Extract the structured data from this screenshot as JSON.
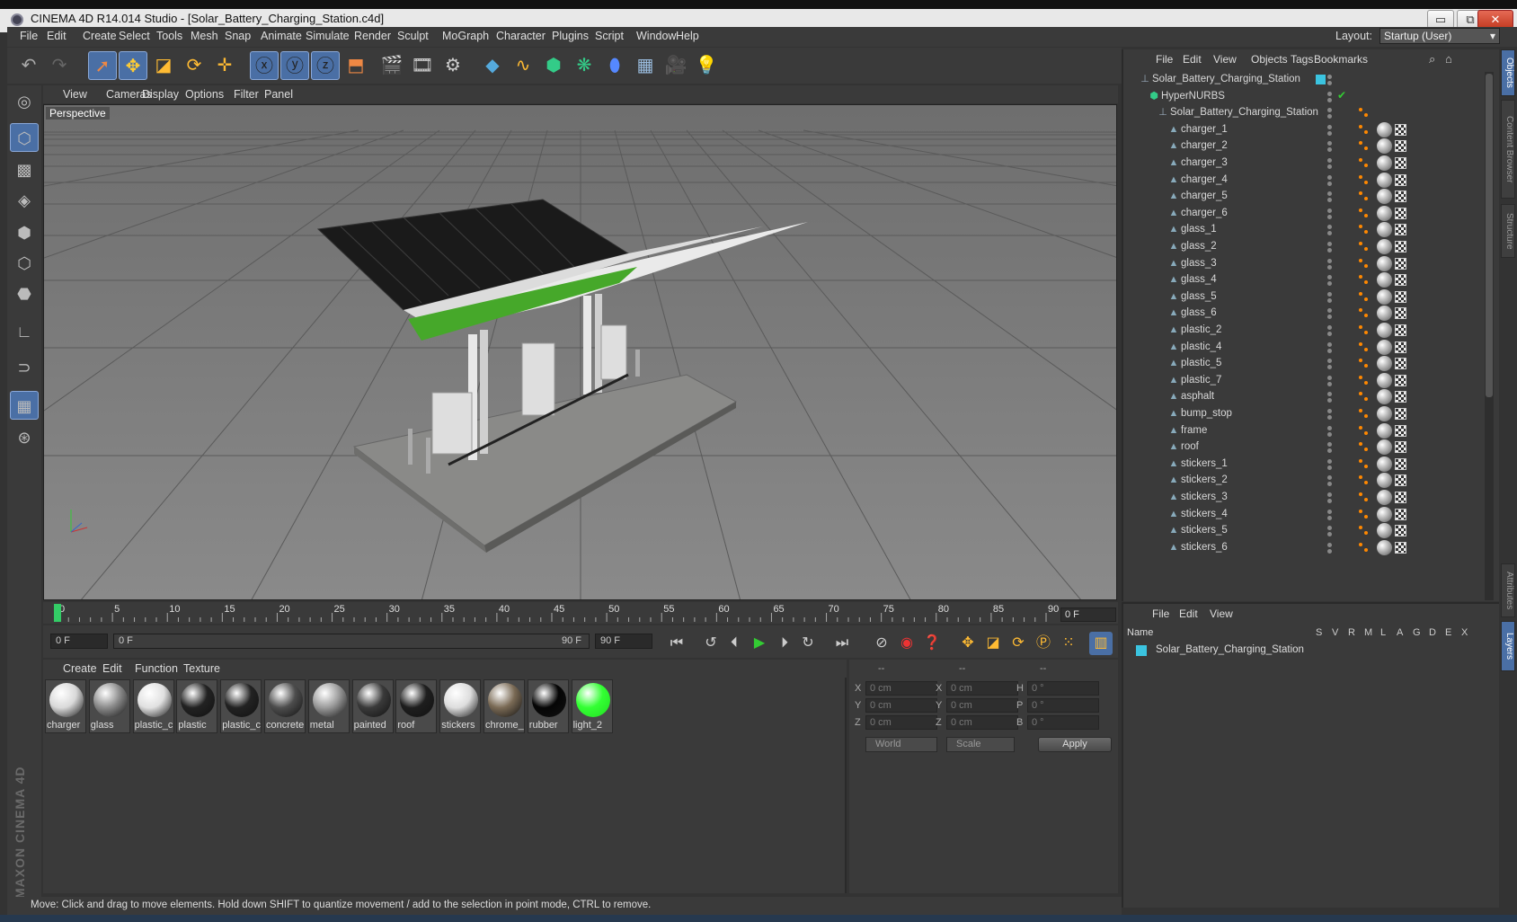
{
  "window": {
    "title": "CINEMA 4D R14.014 Studio - [Solar_Battery_Charging_Station.c4d]",
    "min": "▭",
    "max": "⧉",
    "close": "✕"
  },
  "menubar": {
    "items": [
      "File",
      "Edit",
      "Create",
      "Select",
      "Tools",
      "Mesh",
      "Snap",
      "Animate",
      "Simulate",
      "Render",
      "Sculpt",
      "MoGraph",
      "Character",
      "Plugins",
      "Script",
      "Window",
      "Help"
    ],
    "layout_label": "Layout:",
    "layout_value": "Startup (User)"
  },
  "viewport": {
    "menu": [
      "View",
      "Cameras",
      "Display",
      "Options",
      "Filter",
      "Panel"
    ],
    "label": "Perspective"
  },
  "timeline": {
    "ticks": [
      "0",
      "5",
      "10",
      "15",
      "20",
      "25",
      "30",
      "35",
      "40",
      "45",
      "50",
      "55",
      "60",
      "65",
      "70",
      "75",
      "80",
      "85",
      "90"
    ],
    "current_frame": "0 F",
    "start_field": "0 F",
    "range_start": "0 F",
    "range_end": "90 F",
    "end_field": "90 F"
  },
  "material_manager": {
    "menu": [
      "Create",
      "Edit",
      "Function",
      "Texture"
    ],
    "materials": [
      {
        "name": "charger",
        "color": "#d9d9d9"
      },
      {
        "name": "glass",
        "color": "#8a8a8a"
      },
      {
        "name": "plastic_c",
        "color": "#e0e0e0"
      },
      {
        "name": "plastic",
        "color": "#222222"
      },
      {
        "name": "plastic_c",
        "color": "#222222"
      },
      {
        "name": "concrete",
        "color": "#4d4d4d"
      },
      {
        "name": "metal",
        "color": "#9a9a9a"
      },
      {
        "name": "painted",
        "color": "#3a3a3a"
      },
      {
        "name": "roof",
        "color": "#1e1e1e"
      },
      {
        "name": "stickers",
        "color": "#dddddd"
      },
      {
        "name": "chrome_",
        "color": "#7a6a55"
      },
      {
        "name": "rubber",
        "color": "#050505"
      },
      {
        "name": "light_2",
        "color": "#33ff33"
      }
    ]
  },
  "coordinates": {
    "headers": [
      "--",
      "--",
      "--"
    ],
    "rows": [
      {
        "a": "X",
        "av": "0 cm",
        "b": "X",
        "bv": "0 cm",
        "c": "H",
        "cv": "0 °"
      },
      {
        "a": "Y",
        "av": "0 cm",
        "b": "Y",
        "bv": "0 cm",
        "c": "P",
        "cv": "0 °"
      },
      {
        "a": "Z",
        "av": "0 cm",
        "b": "Z",
        "bv": "0 cm",
        "c": "B",
        "cv": "0 °"
      }
    ],
    "world": "World",
    "scale": "Scale",
    "apply": "Apply"
  },
  "object_manager": {
    "menu": [
      "File",
      "Edit",
      "View",
      "Objects",
      "Tags",
      "Bookmarks"
    ],
    "root": "Solar_Battery_Charging_Station",
    "hypernurbs": "HyperNURBS",
    "group": "Solar_Battery_Charging_Station",
    "children": [
      "charger_1",
      "charger_2",
      "charger_3",
      "charger_4",
      "charger_5",
      "charger_6",
      "glass_1",
      "glass_2",
      "glass_3",
      "glass_4",
      "glass_5",
      "glass_6",
      "plastic_2",
      "plastic_4",
      "plastic_5",
      "plastic_7",
      "asphalt",
      "bump_stop",
      "frame",
      "roof",
      "stickers_1",
      "stickers_2",
      "stickers_3",
      "stickers_4",
      "stickers_5",
      "stickers_6"
    ]
  },
  "layer_manager": {
    "menu": [
      "File",
      "Edit",
      "View"
    ],
    "name_header": "Name",
    "columns": [
      "S",
      "V",
      "R",
      "M",
      "L",
      "A",
      "G",
      "D",
      "E",
      "X"
    ],
    "layer": "Solar_Battery_Charging_Station"
  },
  "side_tabs": [
    "Objects",
    "Content Browser",
    "Structure",
    "Attributes",
    "Layers"
  ],
  "status": "Move: Click and drag to move elements. Hold down SHIFT to quantize movement / add to the selection in point mode, CTRL to remove.",
  "logo": "MAXON CINEMA 4D"
}
